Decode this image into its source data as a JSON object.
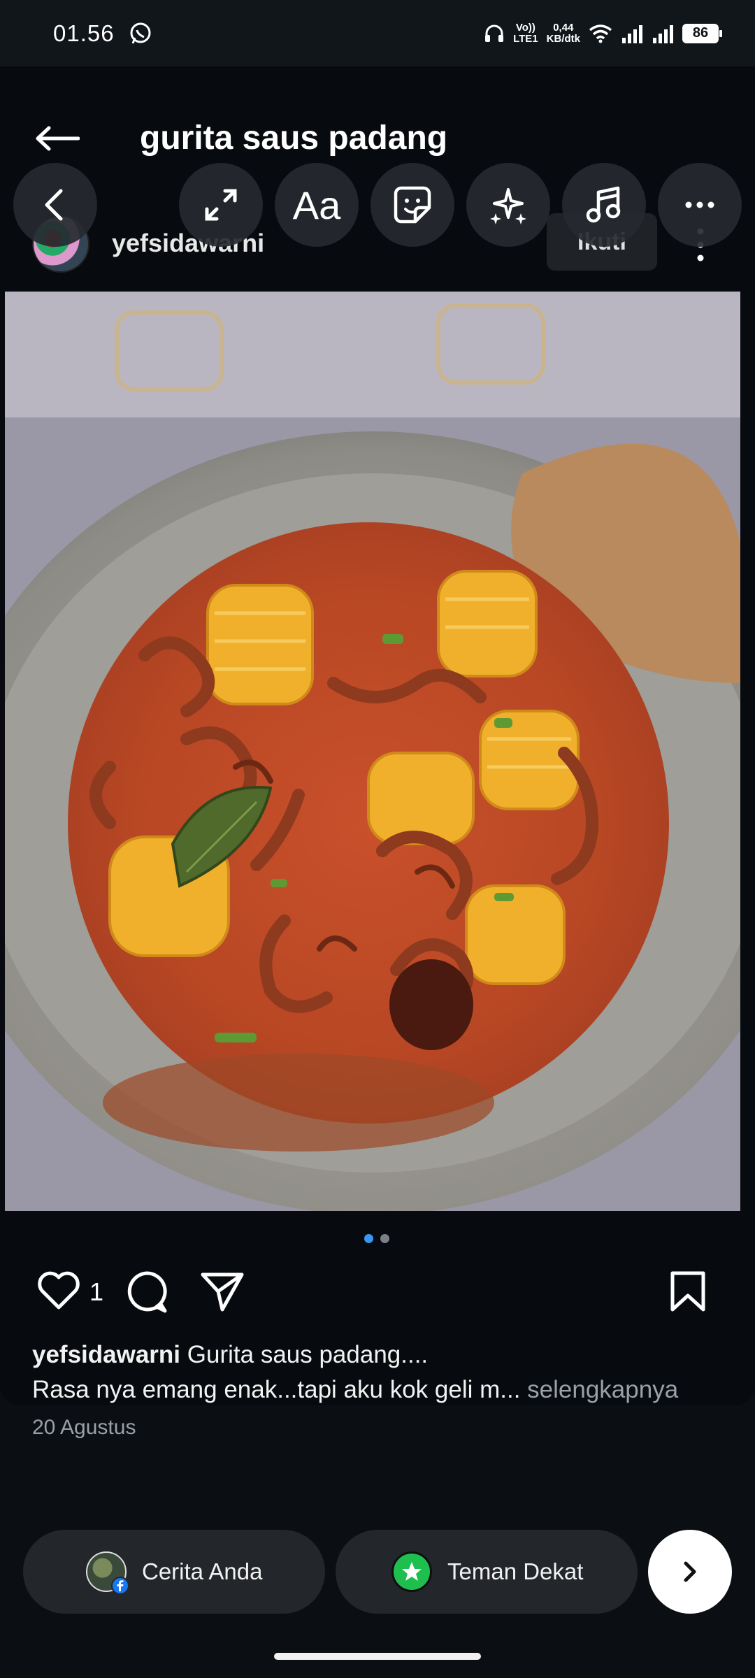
{
  "status_bar": {
    "time": "01.56",
    "net_speed_top": "0,44",
    "net_speed_bottom": "KB/dtk",
    "volte_top": "Vo))",
    "volte_bottom": "LTE1",
    "battery": "86"
  },
  "post": {
    "title": "gurita saus padang",
    "username": "yefsidawarni",
    "follow_label": "Ikuti",
    "likes": "1",
    "caption_user": "yefsidawarni",
    "caption_line1": "Gurita saus padang....",
    "caption_line2": "Rasa nya emang enak...tapi aku kok geli m...",
    "caption_more": "selengkapnya",
    "date": "20 Agustus"
  },
  "editor_tools": [
    "back-icon",
    "resize-icon",
    "text-icon",
    "sticker-icon",
    "effects-icon",
    "music-icon",
    "more-icon"
  ],
  "text_tool_label": "Aa",
  "carousel": {
    "count": 2,
    "active": 1
  },
  "share_bar": {
    "your_story": "Cerita Anda",
    "close_friends": "Teman Dekat"
  },
  "colors": {
    "accent": "#3897f0",
    "close_friends_green": "#1fbf4f",
    "facebook_blue": "#1877f2"
  }
}
